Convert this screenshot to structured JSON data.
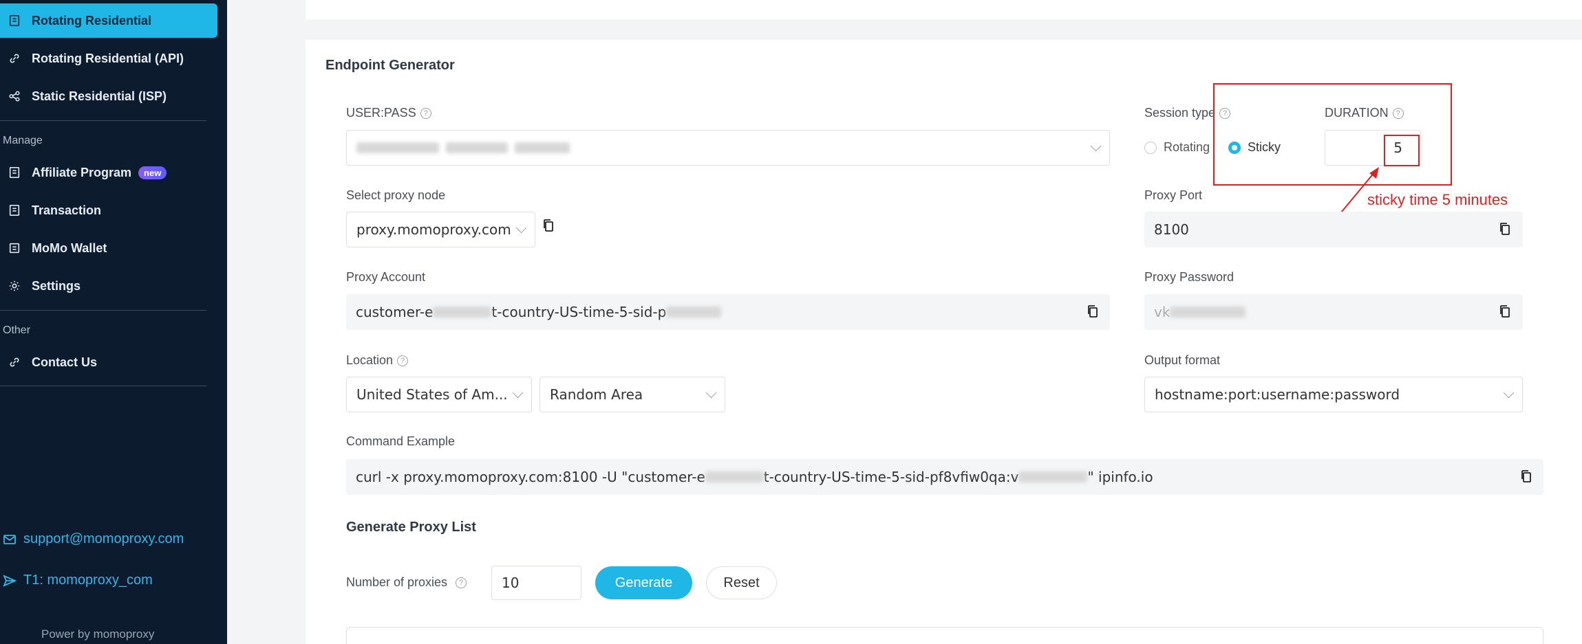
{
  "sidebar": {
    "items": [
      {
        "label": "Rotating Residential",
        "icon": "document-icon"
      },
      {
        "label": "Rotating Residential (API)",
        "icon": "link-icon"
      },
      {
        "label": "Static Residential (ISP)",
        "icon": "network-icon"
      }
    ],
    "manage_label": "Manage",
    "manage_items": [
      {
        "label": "Affiliate Program",
        "badge": "new",
        "icon": "document-icon"
      },
      {
        "label": "Transaction",
        "icon": "document-icon"
      },
      {
        "label": "MoMo Wallet",
        "icon": "wallet-icon"
      },
      {
        "label": "Settings",
        "icon": "gear-icon"
      }
    ],
    "other_label": "Other",
    "other_items": [
      {
        "label": "Contact Us",
        "icon": "link-icon"
      }
    ],
    "email": "support@momoproxy.com",
    "telegram": "T1: momoproxy_com",
    "powered_by": "Power by momoproxy"
  },
  "generator": {
    "title": "Endpoint Generator",
    "userpass_label": "USER:PASS",
    "userpass_value_prefix": "",
    "session_type_label": "Session type",
    "session_rotating": "Rotating",
    "session_sticky": "Sticky",
    "duration_label": "DURATION",
    "duration_value": "5",
    "proxy_node_label": "Select proxy node",
    "proxy_node_value": "proxy.momoproxy.com",
    "proxy_port_label": "Proxy Port",
    "proxy_port_value": "8100",
    "proxy_account_label": "Proxy Account",
    "proxy_account_prefix": "customer-e",
    "proxy_account_mid": "t-country-US-time-5-sid-p",
    "proxy_password_label": "Proxy Password",
    "proxy_password_prefix": "vk",
    "location_label": "Location",
    "location_country": "United States of Am...",
    "location_area": "Random Area",
    "output_format_label": "Output format",
    "output_format_value": "hostname:port:username:password",
    "command_label": "Command Example",
    "command_part1": "curl -x proxy.momoproxy.com:8100 -U \"customer-e",
    "command_part2": "t-country-US-time-5-sid-pf8vfiw0qa:v",
    "command_part3": "\"  ipinfo.io"
  },
  "annotation": {
    "text": "sticky time 5 minutes",
    "color": "#e02020"
  },
  "proxy_list": {
    "title": "Generate Proxy List",
    "count_label": "Number of proxies",
    "count_value": "10",
    "generate_label": "Generate",
    "reset_label": "Reset"
  },
  "colors": {
    "accent": "#1eb7e6",
    "sidebar_bg": "#0d1b2e"
  }
}
